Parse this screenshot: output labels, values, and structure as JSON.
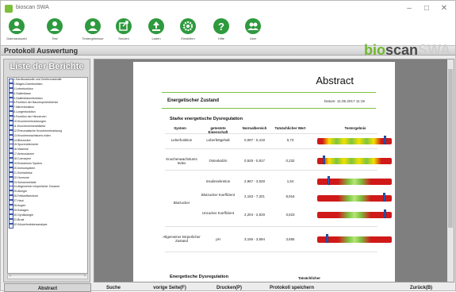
{
  "window": {
    "title": "bioscan SWA"
  },
  "toolbar": {
    "buttons": [
      {
        "label": "Datenauswahl",
        "icon": "user-icon"
      },
      {
        "label": "Test",
        "icon": "user-test-icon"
      },
      {
        "label": "Testergebnisse",
        "icon": "user-results-icon"
      },
      {
        "label": "Senden",
        "icon": "export-icon"
      },
      {
        "label": "Laden",
        "icon": "upload-icon"
      },
      {
        "label": "Einstellen",
        "icon": "gear-icon"
      },
      {
        "label": "Hilfe",
        "icon": "help-icon"
      },
      {
        "label": "User",
        "icon": "users-icon"
      }
    ]
  },
  "header": {
    "title": "Protokoll Auswertung"
  },
  "brand": {
    "part1": "bio",
    "part2": "scan",
    "part3": "SWA"
  },
  "sidebar": {
    "title": "Liste der Berichte",
    "items": [
      "1.Kardiovaskulär und Zerebrovaskulär",
      "2.Magen-Darmfunktion",
      "3.Leberfunktion",
      "4.Gallenblase",
      "5.Gallenblasenfunktion",
      "6.Funktion der Bauchspeicheldrüse",
      "7.Nierenfunktion",
      "8.Lungenfunktion",
      "9.Funktion der Hirnnerven",
      "10.Knochenerkrankungen",
      "11.Knochenmineraldichte",
      "12.Rheumatische Knochenerkrankung",
      "13.Knochenwachstums Index",
      "14.Blutzucker",
      "15.Spurenelemente",
      "16.Vitamine",
      "17.Aminosäuren",
      "18.Coenzyme",
      "19.Endokrines System",
      "20.Immunsystem",
      "21.Schilddrüse",
      "22.Hormone",
      "23.Schwermetalle",
      "24.Allgemeiner körperlicher Zustand",
      "25.Allergie",
      "26.Fettstoffwechsel",
      "27.Haut",
      "28.Augen",
      "29.Kollagen",
      "30.Gynäkologie",
      "31.Brust",
      "32.Körperfunktionsanalyse"
    ]
  },
  "report": {
    "title": "Abstract",
    "section": "Energetischer Zustand",
    "date": "Datum: 11.05.2017 11:19",
    "subtitle": "Starke energetische Dysregulation",
    "columns": {
      "system": "System",
      "property": "getestete Eigenschaft",
      "normal": "Normalbereich",
      "actual": "Tatsächlicher Wert",
      "result": "Testergebnis"
    },
    "rows": [
      {
        "system": "Leberfunktion",
        "property": "Leberfettgehalt",
        "normal": "0,097 - 0,419",
        "value": "0,73",
        "scale": "yellow",
        "marker": 0.92
      },
      {
        "system": "Knochenwachstums Index",
        "property": "Osteokalzin",
        "normal": "0,525 - 0,817",
        "value": "0,232",
        "scale": "yellow",
        "marker": 0.1
      },
      {
        "system": "Blutzucker",
        "property": "Insulinsekretion",
        "normal": "2,967 - 3,528",
        "value": "1,54",
        "scale": "green",
        "marker": 0.16
      },
      {
        "system": "",
        "property": "Blutzucker Koeffizient",
        "normal": "2,163 - 7,321",
        "value": "8,916",
        "scale": "green",
        "marker": 0.9
      },
      {
        "system": "",
        "property": "Unzucker Koeffizient",
        "normal": "2,204 - 2,819",
        "value": "3,623",
        "scale": "green",
        "marker": 0.91
      },
      {
        "system": "Allgemeiner körperlicher Zustand",
        "property": "pH",
        "normal": "3,156 - 3,694",
        "value": "3,655",
        "scale": "green",
        "marker": 0.14
      }
    ],
    "subtitle2": "Energetische Dysregulation",
    "next_header": "Tatsächlicher"
  },
  "bottom": {
    "buttons": [
      "Abstract",
      "Suche",
      "vorige Seite(F)",
      "Drucken(P)",
      "Protokoll speichern",
      "Zurück(B)"
    ]
  }
}
